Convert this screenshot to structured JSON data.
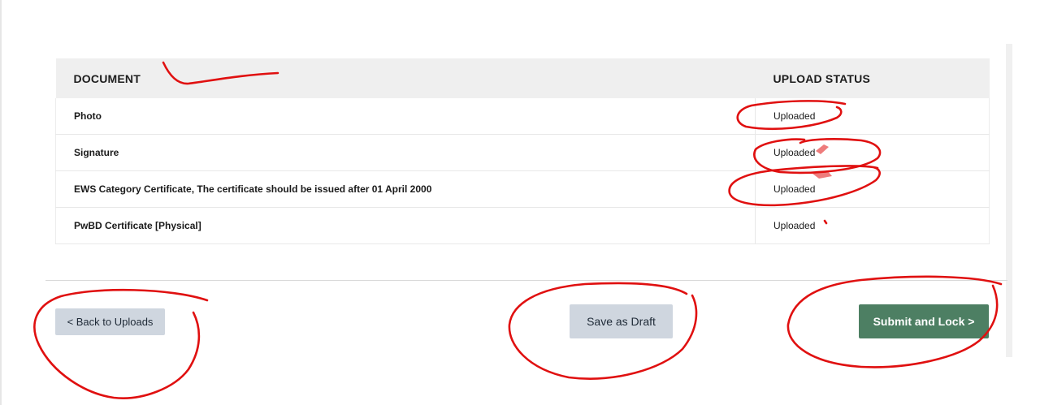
{
  "table": {
    "headers": {
      "document": "DOCUMENT",
      "upload_status": "UPLOAD STATUS"
    },
    "rows": [
      {
        "document": "Photo",
        "status": "Uploaded"
      },
      {
        "document": "Signature",
        "status": "Uploaded"
      },
      {
        "document": "EWS Category Certificate, The certificate should be issued after 01 April 2000",
        "status": "Uploaded"
      },
      {
        "document": "PwBD Certificate [Physical]",
        "status": "Uploaded"
      }
    ]
  },
  "actions": {
    "back_label": "< Back to Uploads",
    "draft_label": "Save as Draft",
    "submit_label": "Submit and Lock >"
  },
  "colors": {
    "header_bg": "#efefef",
    "secondary_button": "#cfd6df",
    "primary_button": "#4d7f63",
    "annotation_ink": "#e01010"
  }
}
